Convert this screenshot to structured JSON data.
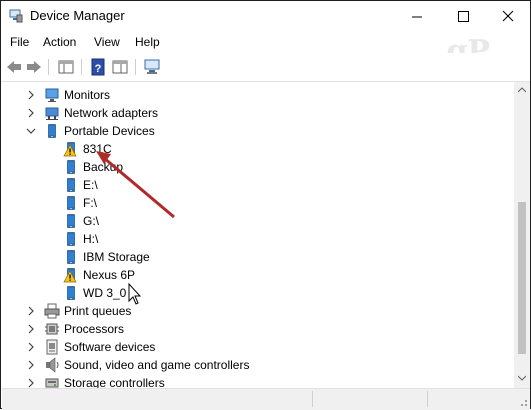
{
  "window": {
    "title": "Device Manager",
    "watermark": "gP"
  },
  "menu": [
    "File",
    "Action",
    "View",
    "Help"
  ],
  "colors": {
    "arrow": "#b02a2a",
    "device_blue": "#2f7fd3",
    "warning": "#f5c518"
  },
  "tree": [
    {
      "label": "Monitors",
      "icon": "monitor-icon",
      "level": 0,
      "expanded": false
    },
    {
      "label": "Network adapters",
      "icon": "network-adapter-icon",
      "level": 0,
      "expanded": false
    },
    {
      "label": "Portable Devices",
      "icon": "portable-device-icon",
      "level": 0,
      "expanded": true
    },
    {
      "label": "831C",
      "icon": "warning-device-icon",
      "level": 1
    },
    {
      "label": "Backup",
      "icon": "portable-device-icon",
      "level": 1
    },
    {
      "label": "E:\\",
      "icon": "portable-device-icon",
      "level": 1
    },
    {
      "label": "F:\\",
      "icon": "portable-device-icon",
      "level": 1
    },
    {
      "label": "G:\\",
      "icon": "portable-device-icon",
      "level": 1
    },
    {
      "label": "H:\\",
      "icon": "portable-device-icon",
      "level": 1
    },
    {
      "label": "IBM Storage",
      "icon": "portable-device-icon",
      "level": 1
    },
    {
      "label": "Nexus 6P",
      "icon": "warning-device-icon",
      "level": 1
    },
    {
      "label": "WD 3_0",
      "icon": "portable-device-icon",
      "level": 1
    },
    {
      "label": "Print queues",
      "icon": "printer-icon",
      "level": 0,
      "expanded": false
    },
    {
      "label": "Processors",
      "icon": "processor-icon",
      "level": 0,
      "expanded": false
    },
    {
      "label": "Software devices",
      "icon": "software-device-icon",
      "level": 0,
      "expanded": false
    },
    {
      "label": "Sound, video and game controllers",
      "icon": "sound-icon",
      "level": 0,
      "expanded": false
    },
    {
      "label": "Storage controllers",
      "icon": "storage-controller-icon",
      "level": 0,
      "expanded": false
    }
  ]
}
